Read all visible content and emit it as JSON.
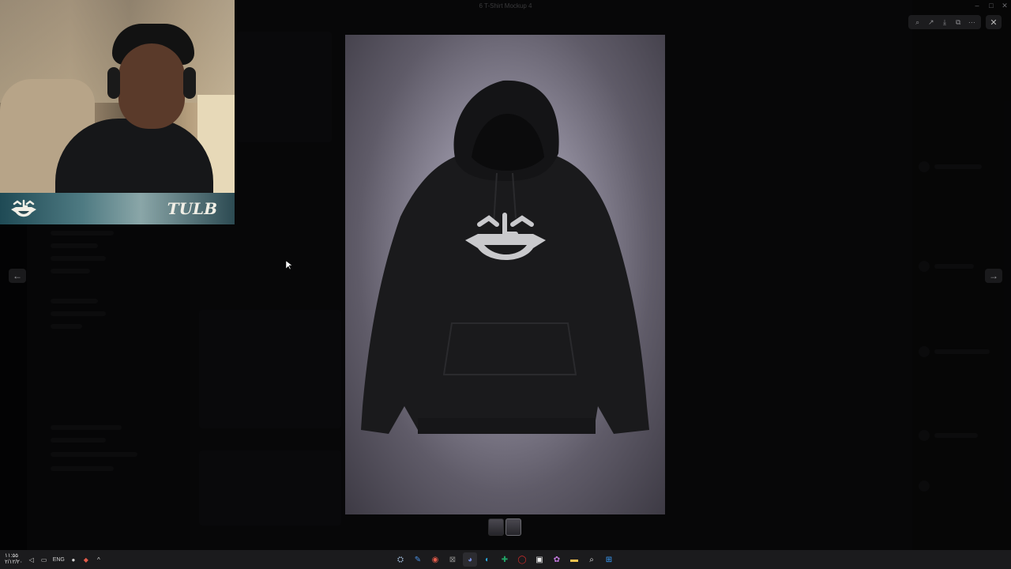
{
  "viewer": {
    "title": "6 T-Shirt Mockup 4",
    "prev_label": "←",
    "next_label": "→",
    "close_label": "✕",
    "toolbar": [
      {
        "name": "zoom-icon",
        "glyph": "⌕"
      },
      {
        "name": "share-icon",
        "glyph": "↗"
      },
      {
        "name": "download-icon",
        "glyph": "⤓"
      },
      {
        "name": "open-in-browser-icon",
        "glyph": "⧉"
      },
      {
        "name": "more-icon",
        "glyph": "⋯"
      }
    ],
    "thumbnails": 2,
    "active_thumbnail": 1
  },
  "webcam": {
    "tag": "TULB"
  },
  "window_controls": {
    "minimize": "–",
    "maximize": "□",
    "close": "✕"
  },
  "taskbar": {
    "date": "۲/۱۲/۲۰",
    "time": "۱۱:۵۵",
    "language": "ENG",
    "tray_icons": [
      "speaker-icon",
      "network-icon",
      "mic-icon",
      "app-tray-icon",
      "chevron-up-icon"
    ],
    "apps": [
      {
        "name": "steam-icon",
        "glyph": "⛭",
        "color": "#9fb7d4"
      },
      {
        "name": "editor-icon",
        "glyph": "✎",
        "color": "#4a90e2"
      },
      {
        "name": "chrome-icon",
        "glyph": "◉",
        "color": "#e25b4a"
      },
      {
        "name": "game-icon",
        "glyph": "⊠",
        "color": "#8a8a8a"
      },
      {
        "name": "discord-icon",
        "glyph": "◕",
        "color": "#7289da",
        "active": true
      },
      {
        "name": "edge-icon",
        "glyph": "◐",
        "color": "#2aa5d8"
      },
      {
        "name": "excel-icon",
        "glyph": "✚",
        "color": "#21a366"
      },
      {
        "name": "opera-icon",
        "glyph": "◯",
        "color": "#d52b2b"
      },
      {
        "name": "store-icon",
        "glyph": "▣",
        "color": "#f0f0f0"
      },
      {
        "name": "copilot-icon",
        "glyph": "✿",
        "color": "#c47ae0"
      },
      {
        "name": "folder-icon",
        "glyph": "▬",
        "color": "#f2c14e"
      },
      {
        "name": "search-icon",
        "glyph": "⌕",
        "color": "#e0e0e0"
      },
      {
        "name": "windows-icon",
        "glyph": "⊞",
        "color": "#3aa0ff"
      }
    ]
  },
  "colors": {
    "hoodie": "#1a1a1c",
    "logo": "#c9c9cc",
    "backdrop": "#8e8a9a"
  }
}
